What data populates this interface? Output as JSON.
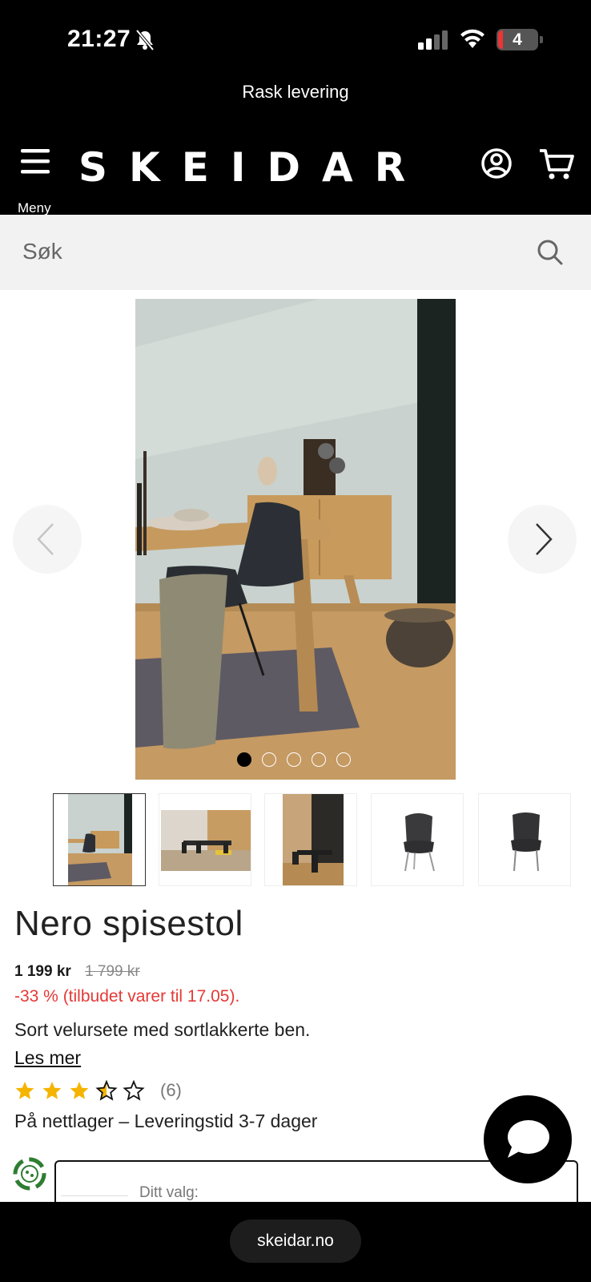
{
  "status_bar": {
    "time": "21:27",
    "battery": "4"
  },
  "promo": {
    "text": "Rask levering"
  },
  "header": {
    "logo": "SKEIDAR",
    "menu_label": "Meny"
  },
  "search": {
    "placeholder": "Søk"
  },
  "gallery": {
    "image_count": 5,
    "active_index": 0
  },
  "product": {
    "title": "Nero spisestol",
    "price": "1 199 kr",
    "old_price": "1 799 kr",
    "discount": "-33 % (tilbudet varer til 17.05).",
    "description": "Sort velursete med sortlakkerte ben.",
    "read_more": "Les mer",
    "rating": 3.5,
    "rating_max": 5,
    "review_count": "(6)",
    "stock": "På nettlager – Leveringstid 3-7 dager",
    "choice_label": "Ditt valg:"
  },
  "browser": {
    "url": "skeidar.no"
  },
  "colors": {
    "discount": "#e53935",
    "background": "#000000",
    "star": "#f5b400"
  }
}
